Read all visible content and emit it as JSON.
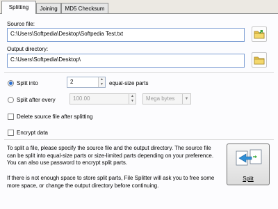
{
  "tabs": [
    {
      "label": "Splitting",
      "active": true
    },
    {
      "label": "Joining",
      "active": false
    },
    {
      "label": "MD5 Checksum",
      "active": false
    }
  ],
  "source": {
    "label": "Source file:",
    "value": "C:\\Users\\Softpedia\\Desktop\\Softpedia Test.txt"
  },
  "output": {
    "label": "Output directory:",
    "value": "C:\\Users\\Softpedia\\Desktop\\"
  },
  "split_into": {
    "label": "Split into",
    "value": "2",
    "suffix": "equal-size parts",
    "checked": true
  },
  "split_every": {
    "label": "Split after every",
    "value": "100.00",
    "unit": "Mega bytes",
    "checked": false
  },
  "delete_source": {
    "label": "Delete source file after splitting",
    "checked": false
  },
  "encrypt": {
    "label": "Encrypt data",
    "checked": false
  },
  "description": {
    "p1": "To split a file, please specify the source file and the output directory. The source file can be split into equal-size parts or size-limited parts depending on your preference. You can also use password to encrypt split parts.",
    "p2": "If there is not enough space to store split parts, File Splitter will ask you to free some more space, or change the output directory before continuing."
  },
  "split_button": {
    "label": "Split"
  },
  "icons": {
    "source_browse": "folder-icon",
    "output_browse": "folder-icon",
    "split": "split-files-icon"
  },
  "colors": {
    "accent": "#2b6fd0",
    "field_border": "#7a9cd3",
    "panel": "#fcfcfe"
  }
}
